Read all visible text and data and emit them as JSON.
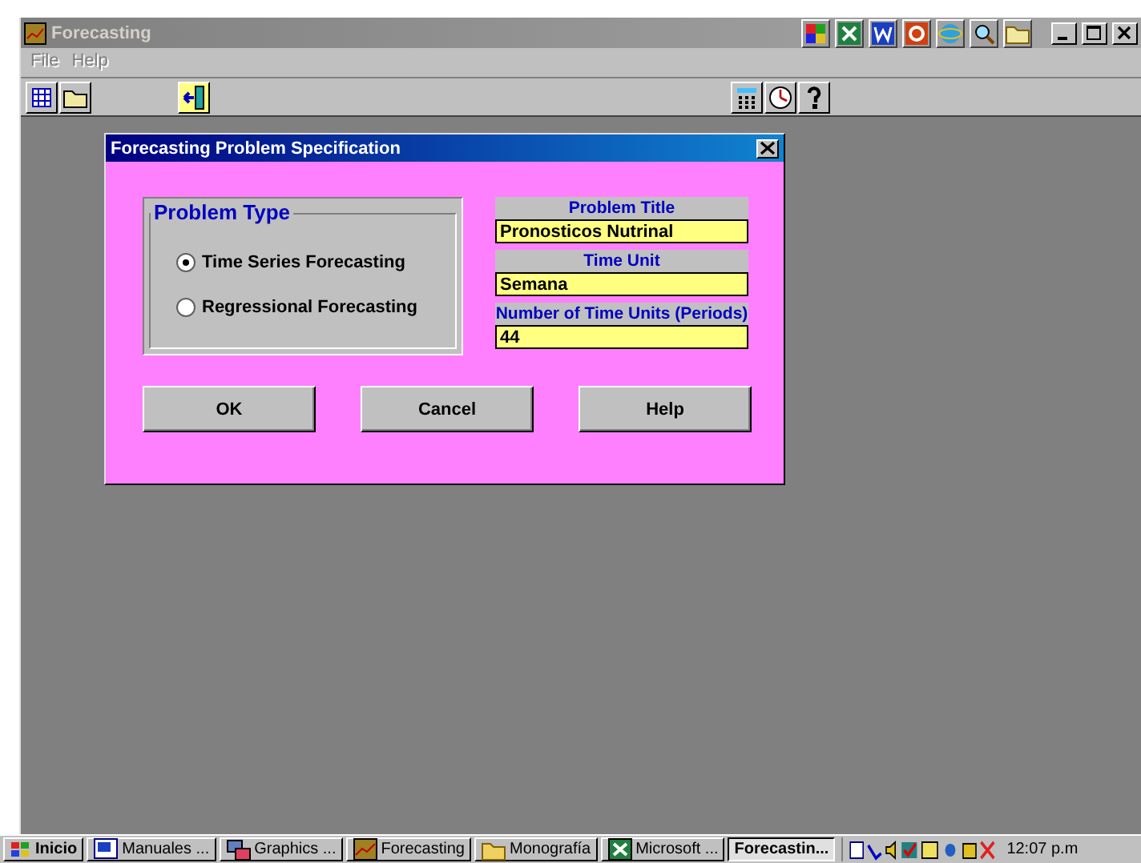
{
  "window": {
    "title": "Forecasting"
  },
  "menu": [
    {
      "label": "File",
      "disabled": true
    },
    {
      "label": "Help",
      "disabled": true
    }
  ],
  "dialog": {
    "title": "Forecasting Problem Specification",
    "group_title": "Problem Type",
    "radios": [
      {
        "label": "Time Series Forecasting",
        "selected": true
      },
      {
        "label": "Regressional Forecasting",
        "selected": false
      }
    ],
    "fields": [
      {
        "label": "Problem Title",
        "value": "Pronosticos Nutrinal"
      },
      {
        "label": "Time Unit",
        "value": "Semana"
      },
      {
        "label": "Number of Time Units (Periods)",
        "value": "44"
      }
    ],
    "buttons": [
      "OK",
      "Cancel",
      "Help"
    ]
  },
  "taskbar": {
    "start": "Inicio",
    "tasks": [
      {
        "label": "Manuales ...",
        "selected": false
      },
      {
        "label": "Graphics ...",
        "selected": false
      },
      {
        "label": "Forecasting",
        "selected": false
      },
      {
        "label": "Monografía",
        "selected": false
      },
      {
        "label": "Microsoft ...",
        "selected": false
      },
      {
        "label": "Forecastin...",
        "selected": true
      }
    ],
    "clock": "12:07 p.m"
  }
}
